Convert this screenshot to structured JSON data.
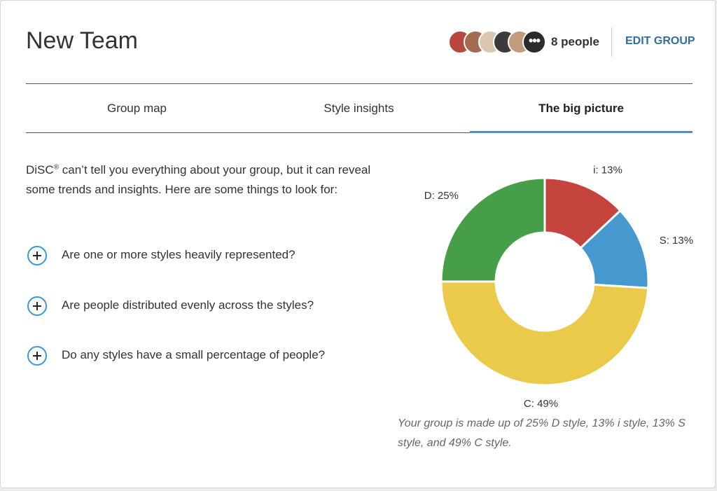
{
  "header": {
    "title": "New Team",
    "people_count": "8 people",
    "more_glyph": "•••",
    "edit_group_label": "EDIT GROUP",
    "avatars": [
      {
        "name": "avatar-1",
        "color": "#b8473e"
      },
      {
        "name": "avatar-2",
        "color": "#a56a52"
      },
      {
        "name": "avatar-3",
        "color": "#d9c7b0"
      },
      {
        "name": "avatar-4",
        "color": "#3b3b3b"
      },
      {
        "name": "avatar-5",
        "color": "#c49a7c"
      }
    ]
  },
  "tabs": [
    {
      "label": "Group map",
      "active": false
    },
    {
      "label": "Style insights",
      "active": false
    },
    {
      "label": "The big picture",
      "active": true
    }
  ],
  "intro": {
    "brand": "DiSC",
    "reg_mark": "®",
    "text": " can’t tell you everything about your group, but it can reveal some trends and insights. Here are some things to look for:"
  },
  "questions": [
    "Are one or more styles heavily represented?",
    "Are people distributed evenly across the styles?",
    "Do any styles have a small percentage of people?"
  ],
  "chart_data": {
    "type": "pie",
    "donut": true,
    "slices": [
      {
        "label": "i: 13%",
        "style": "i",
        "value": 13,
        "color": "#c5443e"
      },
      {
        "label": "S: 13%",
        "style": "S",
        "value": 13,
        "color": "#4599cf"
      },
      {
        "label": "C: 49%",
        "style": "C",
        "value": 49,
        "color": "#ebc94a"
      },
      {
        "label": "D: 25%",
        "style": "D",
        "value": 25,
        "color": "#469e48"
      }
    ]
  },
  "caption": "Your group is made up of 25% D style, 13% i style, 13% S style, and 49% C style."
}
